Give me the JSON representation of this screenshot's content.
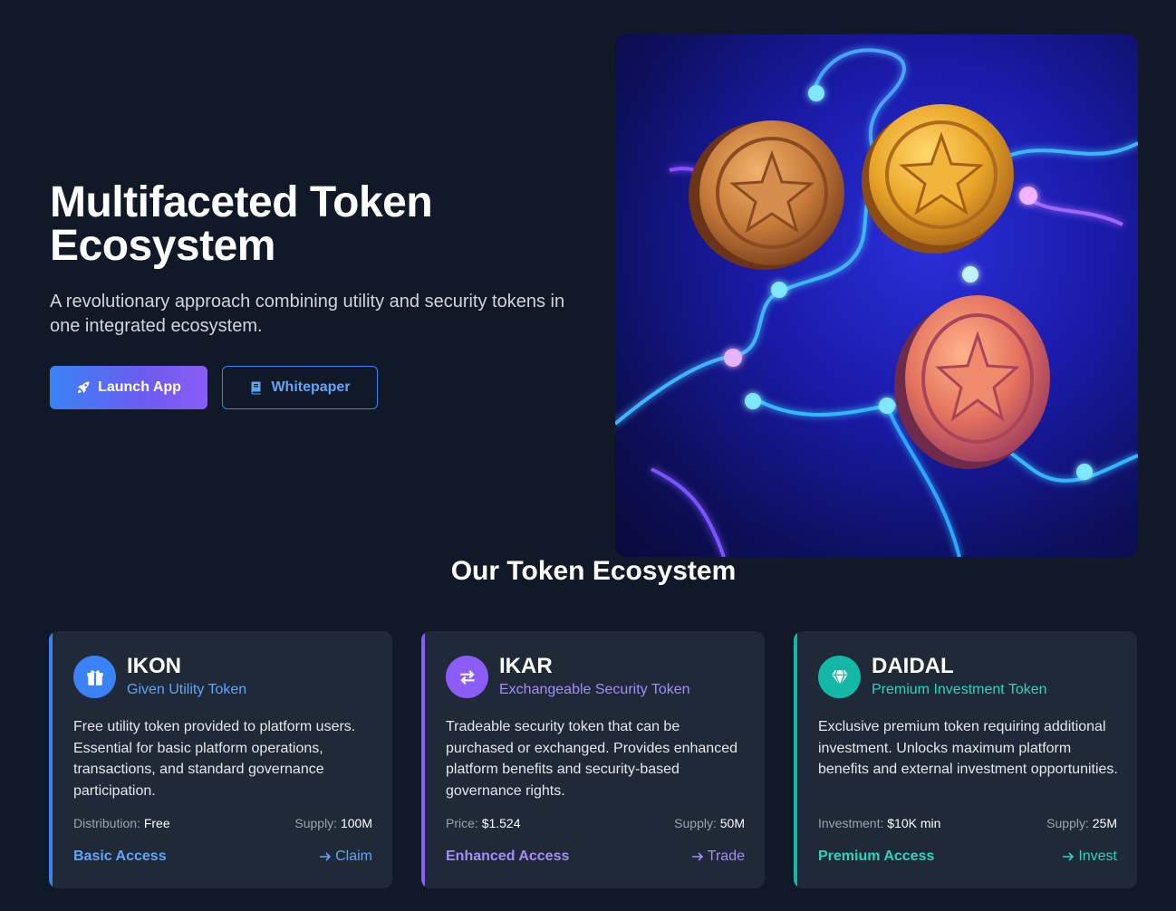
{
  "hero": {
    "title": "Multifaceted Token Ecosystem",
    "subtitle": "A revolutionary approach combining utility and security tokens in one integrated ecosystem.",
    "launch_label": "Launch App",
    "whitepaper_label": "Whitepaper"
  },
  "section_title": "Our Token Ecosystem",
  "cards": [
    {
      "name": "IKON",
      "type": "Given Utility Token",
      "description": "Free utility token provided to platform users. Essential for basic platform operations, transactions, and standard governance participation.",
      "stat_left_label": "Distribution:",
      "stat_left_value": "Free",
      "stat_right_label": "Supply:",
      "stat_right_value": "100M",
      "access": "Basic Access",
      "action": "Claim",
      "icon": "gift-icon",
      "color": "#3b82f6"
    },
    {
      "name": "IKAR",
      "type": "Exchangeable Security Token",
      "description": "Tradeable security token that can be purchased or exchanged. Provides enhanced platform benefits and security-based governance rights.",
      "stat_left_label": "Price:",
      "stat_left_value": "$1.524",
      "stat_right_label": "Supply:",
      "stat_right_value": "50M",
      "access": "Enhanced Access",
      "action": "Trade",
      "icon": "exchange-icon",
      "color": "#8b5cf6"
    },
    {
      "name": "DAIDAL",
      "type": "Premium Investment Token",
      "description": "Exclusive premium token requiring additional investment. Unlocks maximum platform benefits and external investment opportunities.",
      "stat_left_label": "Investment:",
      "stat_left_value": "$10K min",
      "stat_right_label": "Supply:",
      "stat_right_value": "25M",
      "access": "Premium Access",
      "action": "Invest",
      "icon": "gem-icon",
      "color": "#14b8a6"
    }
  ]
}
